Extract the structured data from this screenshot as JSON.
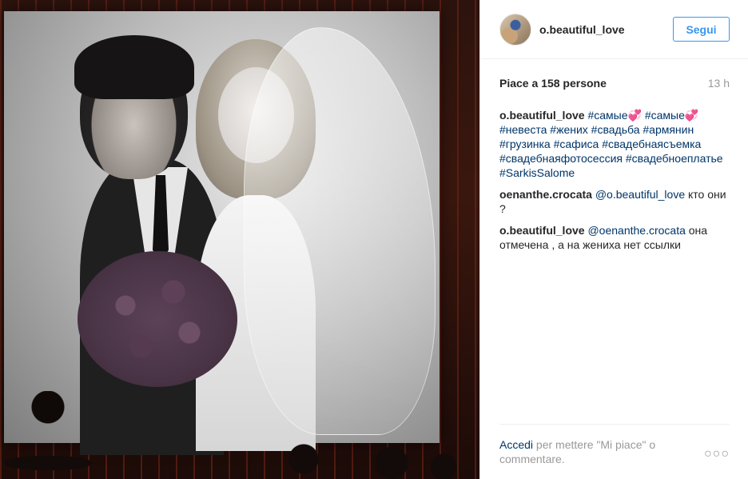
{
  "post": {
    "username": "o.beautiful_love",
    "follow_label": "Segui",
    "likes_prefix": "Piace a ",
    "likes_count": "158",
    "likes_suffix": " persone",
    "time_ago": "13 h"
  },
  "caption": {
    "username": "o.beautiful_love",
    "text": "#самые💞 #самые💞 #невеста #жених #свадьба #армянин #грузинка #сафиса #свадебнаясъемка #свадебнаяфотосессия #свадебноеплатье #SarkisSalome"
  },
  "comments": [
    {
      "username": "oenanthe.crocata",
      "mention": "@o.beautiful_love",
      "text": " кто они ?"
    },
    {
      "username": "o.beautiful_love",
      "mention": "@oenanthe.crocata",
      "text": " она отмечена , а на жениха нет ссылки"
    }
  ],
  "footer": {
    "login_link": "Accedi",
    "login_rest": " per mettere \"Mi piace\" o commentare.",
    "more_icon": "more-options-icon",
    "more_glyph": "○○○"
  },
  "colors": {
    "link": "#003569",
    "follow": "#3897f0",
    "muted": "#999999"
  }
}
